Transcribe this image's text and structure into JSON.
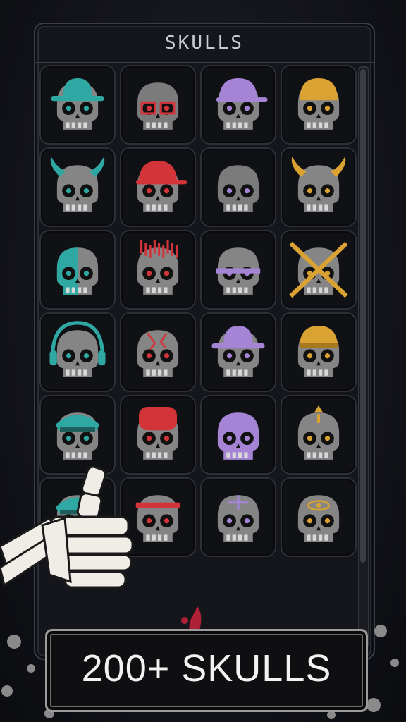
{
  "panel": {
    "title": "SKULLS"
  },
  "banner": {
    "text": "200+ SKULLS"
  },
  "colors": {
    "teal": "#2fa7a3",
    "gray": "#7b7b7b",
    "purple": "#a584d6",
    "gold": "#d9a232",
    "red": "#d3343a",
    "bone": "#e9e6df"
  },
  "skulls": [
    {
      "name": "teal-bucket-hat-skull",
      "color": "teal",
      "eyes": "teal",
      "hat": "bucket"
    },
    {
      "name": "red-glasses-skull",
      "color": "gray",
      "eyes": "red",
      "hat": "glasses"
    },
    {
      "name": "purple-headset-skull",
      "color": "purple",
      "eyes": "purple",
      "hat": "cap"
    },
    {
      "name": "gold-helmet-skull",
      "color": "gold",
      "eyes": "gold",
      "hat": "helmet"
    },
    {
      "name": "teal-horned-skull",
      "color": "teal",
      "eyes": "teal",
      "hat": "horns"
    },
    {
      "name": "red-cap-skull",
      "color": "red",
      "eyes": "red",
      "hat": "cap"
    },
    {
      "name": "purple-tears-skull",
      "color": "gray",
      "eyes": "purple",
      "hat": "none"
    },
    {
      "name": "gold-antlers-skull",
      "color": "gold",
      "eyes": "gold",
      "hat": "horns"
    },
    {
      "name": "teal-half-skull",
      "color": "teal",
      "eyes": "teal",
      "hat": "half"
    },
    {
      "name": "red-punk-skull",
      "color": "red",
      "eyes": "red",
      "hat": "punk"
    },
    {
      "name": "purple-strapped-skull",
      "color": "purple",
      "eyes": "purple",
      "hat": "strap"
    },
    {
      "name": "gold-crossbones-skull",
      "color": "gold",
      "eyes": "gold",
      "hat": "bones"
    },
    {
      "name": "teal-headphones-skull",
      "color": "teal",
      "eyes": "teal",
      "hat": "headphones"
    },
    {
      "name": "red-cracked-skull",
      "color": "red",
      "eyes": "red",
      "hat": "cracks"
    },
    {
      "name": "purple-bucket-hat-skull",
      "color": "purple",
      "eyes": "purple",
      "hat": "bucket"
    },
    {
      "name": "gold-beanie-skull",
      "color": "gold",
      "eyes": "gold",
      "hat": "beanie"
    },
    {
      "name": "teal-officer-cap-skull",
      "color": "teal",
      "eyes": "teal",
      "hat": "officer"
    },
    {
      "name": "red-chef-hat-skull",
      "color": "red",
      "eyes": "red",
      "hat": "chef"
    },
    {
      "name": "purple-ghost-skull",
      "color": "purple",
      "eyes": "purple",
      "hat": "ghost"
    },
    {
      "name": "gold-drip-skull",
      "color": "gold",
      "eyes": "gold",
      "hat": "drip"
    },
    {
      "name": "teal-partial-skull",
      "color": "teal",
      "eyes": "teal",
      "hat": "officer"
    },
    {
      "name": "red-visor-skull",
      "color": "red",
      "eyes": "red",
      "hat": "visor"
    },
    {
      "name": "purple-circuit-skull",
      "color": "purple",
      "eyes": "purple",
      "hat": "circuit"
    },
    {
      "name": "gold-eye-skull",
      "color": "gold",
      "eyes": "gold",
      "hat": "eye"
    }
  ]
}
